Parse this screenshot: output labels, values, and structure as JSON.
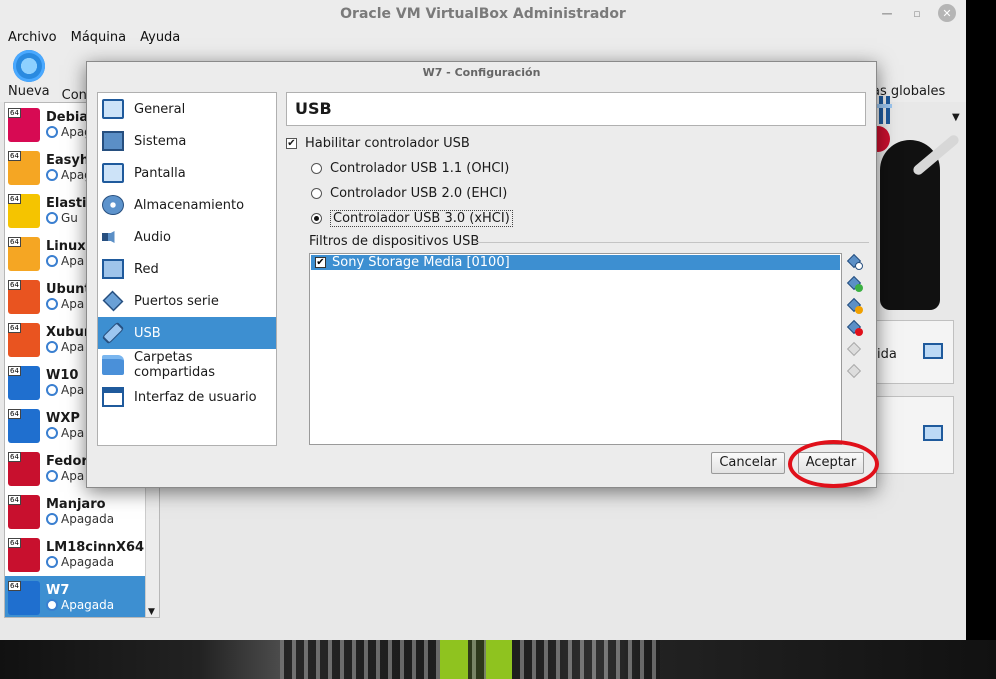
{
  "app": {
    "title": "Oracle VM VirtualBox Administrador",
    "menu": [
      "Archivo",
      "Máquina",
      "Ayuda"
    ],
    "toolbar": {
      "new_label": "Nueva",
      "config_label": "Con",
      "global_tools_label": "as globales"
    }
  },
  "vm_list": [
    {
      "name": "Debia",
      "state": "Apag",
      "icon": "debian-icon",
      "color": "#d70a53"
    },
    {
      "name": "Easyh",
      "state": "Apag",
      "icon": "linux-icon",
      "color": "#f5a623"
    },
    {
      "name": "Elasti",
      "state": "Gu",
      "icon": "elastix-icon",
      "color": "#f5c400"
    },
    {
      "name": "Linuxl",
      "state": "Apa",
      "icon": "linux-icon",
      "color": "#f5a623"
    },
    {
      "name": "Ubunt",
      "state": "Apa",
      "icon": "ubuntu-icon",
      "color": "#e95420"
    },
    {
      "name": "Xubur",
      "state": "Apa",
      "icon": "ubuntu-icon",
      "color": "#e95420"
    },
    {
      "name": "W10",
      "state": "Apa",
      "icon": "windows-icon",
      "color": "#1f6fcf"
    },
    {
      "name": "WXP",
      "state": "Apa",
      "icon": "windows-icon",
      "color": "#1f6fcf"
    },
    {
      "name": "Fedor",
      "state": "Apa",
      "icon": "fedora-icon",
      "color": "#c8102e"
    },
    {
      "name": "Manjaro",
      "state": "Apagada",
      "icon": "linux-icon",
      "color": "#c8102e"
    },
    {
      "name": "LM18cinnX64",
      "state": "Apagada",
      "icon": "linux-icon",
      "color": "#c8102e"
    },
    {
      "name": "W7",
      "state": "Apagada",
      "icon": "windows-icon",
      "color": "#1f6fcf",
      "selected": true
    }
  ],
  "right_panel": {
    "text_a": "ida"
  },
  "dialog": {
    "title": "W7 - Configuración",
    "categories": [
      {
        "label": "General",
        "icon": "monitor-icon"
      },
      {
        "label": "Sistema",
        "icon": "chip-icon"
      },
      {
        "label": "Pantalla",
        "icon": "display-icon"
      },
      {
        "label": "Almacenamiento",
        "icon": "disk-icon"
      },
      {
        "label": "Audio",
        "icon": "speaker-icon"
      },
      {
        "label": "Red",
        "icon": "network-icon"
      },
      {
        "label": "Puertos serie",
        "icon": "serial-port-icon"
      },
      {
        "label": "USB",
        "icon": "usb-icon",
        "selected": true
      },
      {
        "label": "Carpetas compartidas",
        "icon": "folder-icon"
      },
      {
        "label": "Interfaz de usuario",
        "icon": "window-icon"
      }
    ],
    "section_title": "USB",
    "enable_usb_label": "Habilitar controlador USB",
    "enable_usb_checked": true,
    "usb_options": [
      {
        "label": "Controlador USB 1.1 (OHCI)",
        "checked": false
      },
      {
        "label": "Controlador USB 2.0 (EHCI)",
        "checked": false
      },
      {
        "label": "Controlador USB 3.0 (xHCI)",
        "checked": true
      }
    ],
    "filters_label": "Filtros de dispositivos USB",
    "filters": [
      {
        "label": "Sony Storage Media [0100]",
        "checked": true
      }
    ],
    "filter_tools": [
      "add-empty-filter-icon",
      "add-device-filter-icon",
      "edit-filter-icon",
      "remove-filter-icon",
      "move-up-icon",
      "move-down-icon"
    ],
    "cancel_label": "Cancelar",
    "accept_label": "Aceptar"
  },
  "colors": {
    "selection": "#3d8fd1",
    "highlight_ellipse": "#e0101a"
  }
}
